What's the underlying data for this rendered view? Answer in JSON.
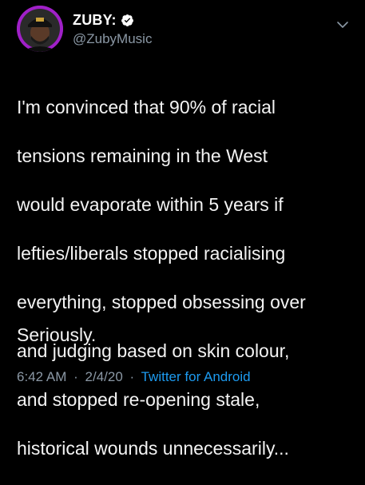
{
  "tweet": {
    "display_name": "ZUBY:",
    "handle": "@ZubyMusic",
    "body_lines": [
      "I'm convinced that 90% of racial",
      "tensions remaining in the West",
      "would evaporate within 5 years if",
      "lefties/liberals stopped racialising",
      "everything, stopped obsessing over",
      "and judging based on skin colour,",
      "and stopped re-opening stale,",
      "historical wounds unnecessarily..."
    ],
    "closing_line": "Seriously.",
    "time": "6:42 AM",
    "date": "2/4/20",
    "separator": "·",
    "source": "Twitter for Android"
  },
  "colors": {
    "background": "#000000",
    "text": "#ffffff",
    "muted": "#8b98a5",
    "link": "#1d9bf0",
    "avatar_ring": "#a020c8"
  },
  "icons": [
    "avatar",
    "verified-badge-icon",
    "chevron-down-icon"
  ]
}
